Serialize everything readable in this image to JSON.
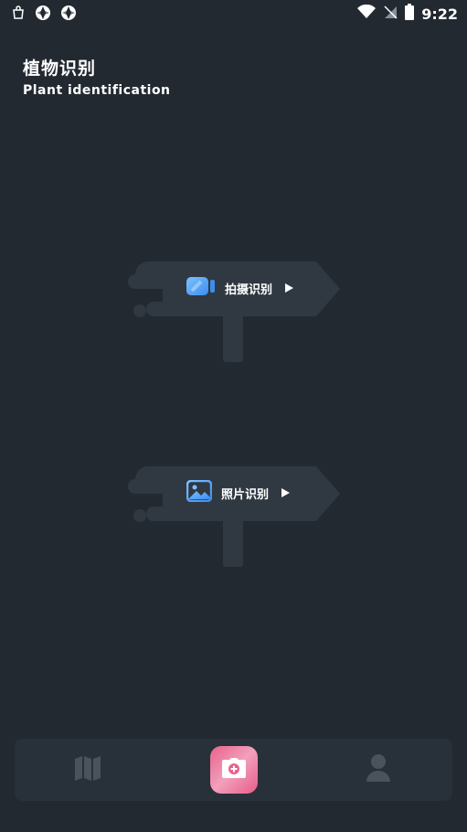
{
  "status_bar": {
    "time": "9:22",
    "left_icons": [
      "bag-notification-icon",
      "aperture-icon",
      "aperture-icon"
    ],
    "right_icons": [
      "wifi-icon",
      "no-signal-icon",
      "battery-icon"
    ]
  },
  "header": {
    "title_zh": "植物识别",
    "title_en": "Plant identification"
  },
  "actions": [
    {
      "label": "拍摄识别",
      "icon": "video-camera-icon",
      "color": "#4da3ff"
    },
    {
      "label": "照片识别",
      "icon": "image-icon",
      "color": "#4da3ff"
    }
  ],
  "bottom_nav": {
    "items": [
      "map-icon",
      "camera-plus-icon",
      "person-icon"
    ],
    "accent": "#e8628a"
  },
  "colors": {
    "background": "#232931",
    "sign": "#303841",
    "nav": "#283039"
  }
}
